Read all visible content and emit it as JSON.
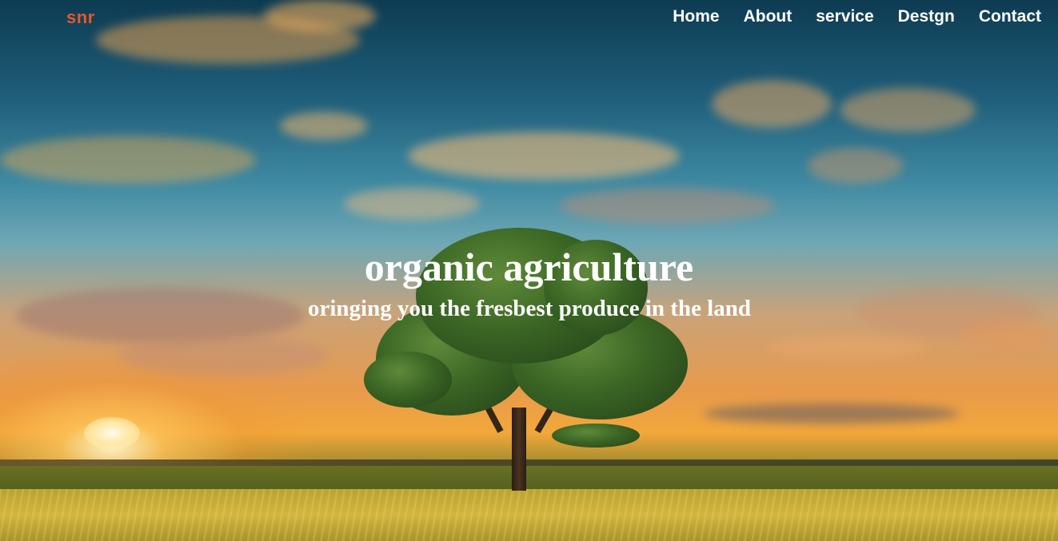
{
  "nav": {
    "logo": "snr",
    "items": [
      {
        "label": "Home"
      },
      {
        "label": "About"
      },
      {
        "label": "service"
      },
      {
        "label": "Destgn"
      },
      {
        "label": "Contact"
      }
    ]
  },
  "hero": {
    "title": "organic agriculture",
    "subtitle": "oringing you the fresbest produce in the land"
  },
  "colors": {
    "logo": "#e8562a",
    "nav_text": "#ffffff",
    "hero_text": "#ffffff"
  }
}
